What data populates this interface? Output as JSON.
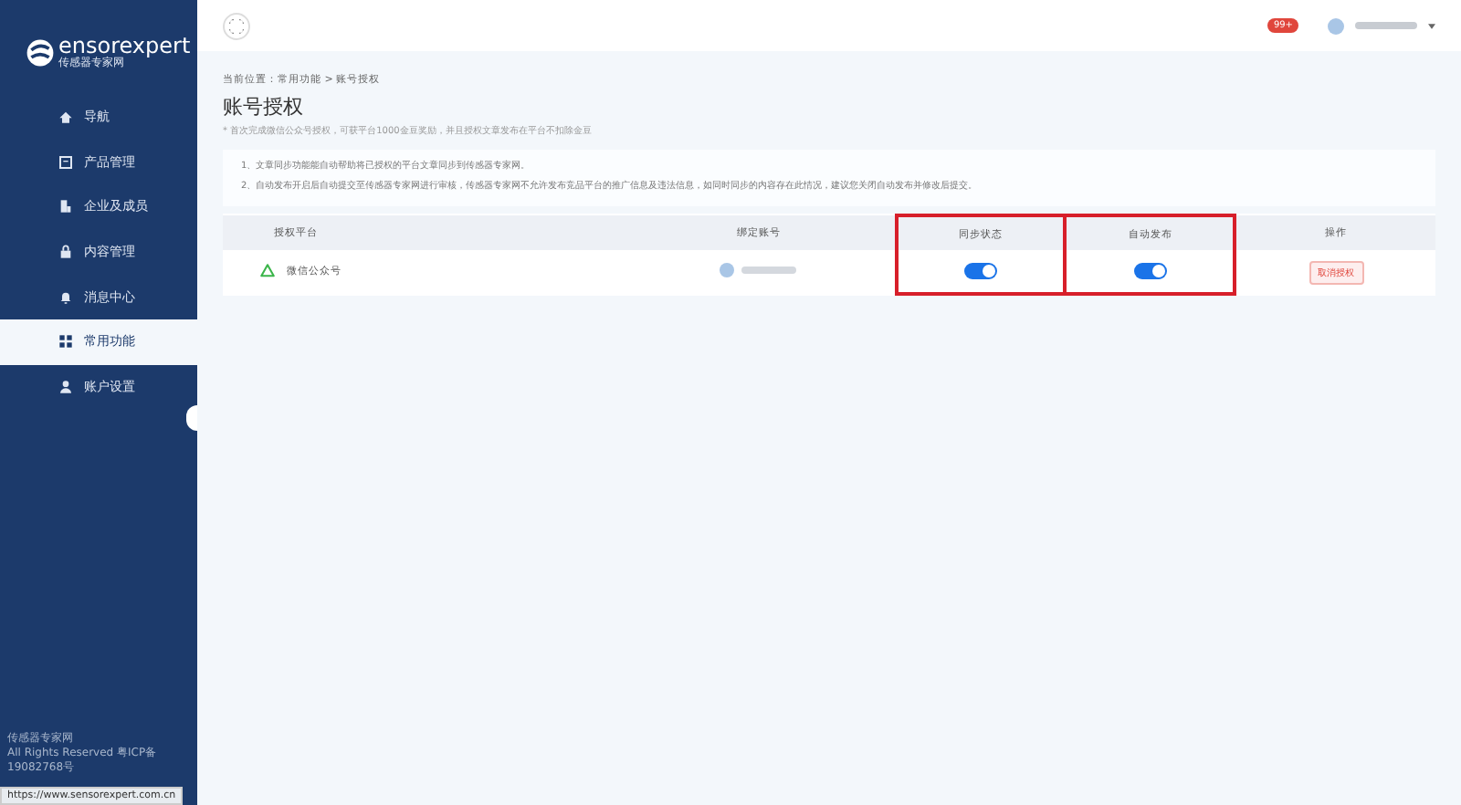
{
  "sidebar": {
    "logo": {
      "brand": "ensorexpert",
      "subtitle": "传感器专家网"
    },
    "items": [
      {
        "label": "导航",
        "selected": false
      },
      {
        "label": "产品管理",
        "selected": false
      },
      {
        "label": "企业及成员",
        "selected": false
      },
      {
        "label": "内容管理",
        "selected": false
      },
      {
        "label": "消息中心",
        "selected": false
      },
      {
        "label": "常用功能",
        "selected": true
      },
      {
        "label": "账户设置",
        "selected": false
      }
    ],
    "footer": [
      "传感器专家网",
      "All Rights Reserved 粤ICP备19082768号"
    ]
  },
  "header": {
    "badge": "99+"
  },
  "breadcrumb": "当前位置：常用功能 > 账号授权",
  "page_title": "账号授权",
  "note": "* 首次完成微信公众号授权，可获平台1000金豆奖励，并且授权文章发布在平台不扣除金豆",
  "info": [
    "1、文章同步功能能自动帮助将已授权的平台文章同步到传感器专家网。",
    "2、自动发布开启后自动提交至传感器专家网进行审核，传感器专家网不允许发布竞品平台的推广信息及违法信息，如同时同步的内容存在此情况，建议您关闭自动发布并修改后提交。"
  ],
  "table": {
    "columns": [
      {
        "label": "授权平台",
        "highlighted": false
      },
      {
        "label": "绑定账号",
        "highlighted": false
      },
      {
        "label": "同步状态",
        "highlighted": true
      },
      {
        "label": "自动发布",
        "highlighted": true
      },
      {
        "label": "操作",
        "highlighted": false
      }
    ],
    "rows": [
      {
        "platform": "微信公众号",
        "sync_on": true,
        "auto_publish_on": true,
        "action": "取消授权"
      }
    ]
  },
  "status_bar": "https://www.sensorexpert.com.cn"
}
